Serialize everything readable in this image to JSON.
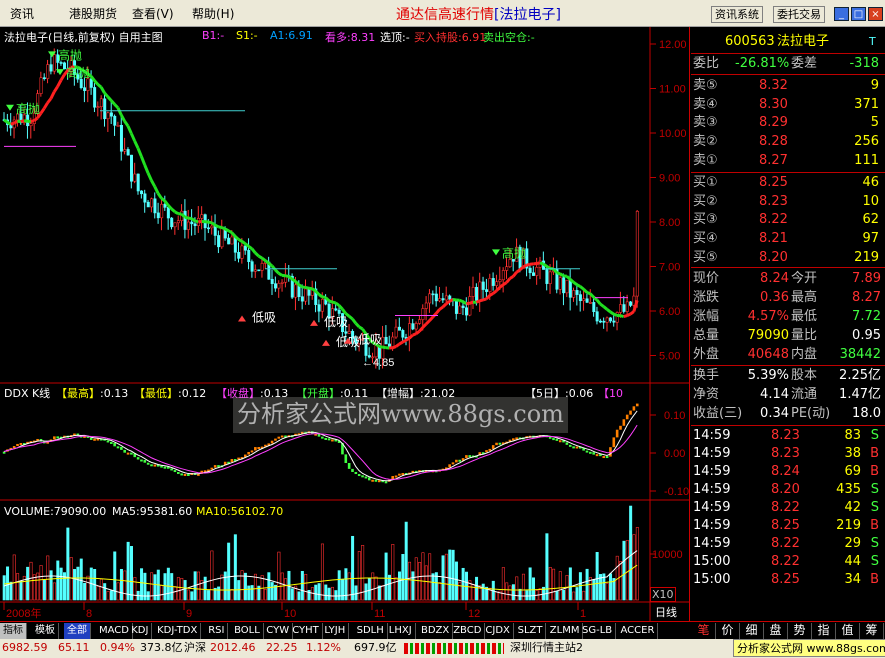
{
  "menu": {
    "items": [
      "资讯",
      "港股期货",
      "查看(V)",
      "帮助(H)"
    ],
    "title": "通达信高速行情",
    "stock_bracket": "[法拉电子]",
    "btn_info": "资讯系统",
    "btn_trade": "委托交易"
  },
  "chart": {
    "header": "法拉电子(日线,前复权) 自用主图",
    "indicators": [
      {
        "label": "B1:-",
        "color": "#ff40ff"
      },
      {
        "label": "S1:-",
        "color": "#ffff00"
      },
      {
        "label": "A1:6.91",
        "color": "#00a0ff"
      },
      {
        "label": "看多:8.31",
        "color": "#ff40ff"
      },
      {
        "label": "选顶:-",
        "color": "#ffffff"
      },
      {
        "label": "买入持股:6.91",
        "color": "#ff3030"
      },
      {
        "label": "卖出空仓:-",
        "color": "#40ff40"
      }
    ],
    "price_ticks": [
      "12.00",
      "11.00",
      "10.00",
      "9.00",
      "8.00",
      "7.00",
      "6.00",
      "5.00"
    ],
    "annotations": {
      "high_sell": "高抛",
      "low_buy": "低吸",
      "low_mark": "4.85"
    },
    "ddx": {
      "label": "DDX K线",
      "items": [
        {
          "k": "【最高】",
          "v": ":0.13"
        },
        {
          "k": "【最低】",
          "v": ":0.12"
        },
        {
          "k": "【收盘】",
          "v": ":0.13"
        },
        {
          "k": "【开盘】",
          "v": ":0.11"
        },
        {
          "k": "【增幅】",
          "v": ":21.02"
        },
        {
          "k": "【5日】",
          "v": ":0.06"
        },
        {
          "k": "【10",
          "v": ""
        }
      ],
      "ticks": [
        "0.10",
        "0.00",
        "-0.10"
      ]
    },
    "volume": {
      "label": "VOLUME:79090.00",
      "ma5": "MA5:95381.60",
      "ma10": "MA10:56102.70",
      "tick": "10000",
      "unit": "X10"
    },
    "time_axis": [
      "2008年",
      "8",
      "9",
      "10",
      "11",
      "12",
      "1"
    ],
    "period": "日线",
    "watermark": "分析家公式网www.88gs.com",
    "chart_data": {
      "type": "candlestick",
      "x": [
        "2008-07",
        "2008-08",
        "2008-09",
        "2008-10",
        "2008-11",
        "2008-12",
        "2009-01"
      ],
      "ylim": [
        4.7,
        12.1
      ],
      "y_ticks": [
        5,
        6,
        7,
        8,
        9,
        10,
        11,
        12
      ],
      "price_high": 11.9,
      "price_low": 4.85,
      "last_close": 8.24
    }
  },
  "quote": {
    "code": "600563",
    "name": "法拉电子",
    "weibi_label": "委比",
    "weibi": "-26.81%",
    "weicha_label": "委差",
    "weicha": "-318",
    "asks": [
      {
        "label": "卖⑤",
        "price": "8.32",
        "vol": "9"
      },
      {
        "label": "卖④",
        "price": "8.30",
        "vol": "371"
      },
      {
        "label": "卖③",
        "price": "8.29",
        "vol": "5"
      },
      {
        "label": "卖②",
        "price": "8.28",
        "vol": "256"
      },
      {
        "label": "卖①",
        "price": "8.27",
        "vol": "111"
      }
    ],
    "bids": [
      {
        "label": "买①",
        "price": "8.25",
        "vol": "46"
      },
      {
        "label": "买②",
        "price": "8.23",
        "vol": "10"
      },
      {
        "label": "买③",
        "price": "8.22",
        "vol": "62"
      },
      {
        "label": "买④",
        "price": "8.21",
        "vol": "97"
      },
      {
        "label": "买⑤",
        "price": "8.20",
        "vol": "219"
      }
    ],
    "stats": [
      {
        "l1": "现价",
        "v1": "8.24",
        "c1": "#ff3030",
        "l2": "今开",
        "v2": "7.89",
        "c2": "#ff3030"
      },
      {
        "l1": "涨跌",
        "v1": "0.36",
        "c1": "#ff3030",
        "l2": "最高",
        "v2": "8.27",
        "c2": "#ff3030"
      },
      {
        "l1": "涨幅",
        "v1": "4.57%",
        "c1": "#ff3030",
        "l2": "最低",
        "v2": "7.72",
        "c2": "#40ff40"
      },
      {
        "l1": "总量",
        "v1": "79090",
        "c1": "#ffff00",
        "l2": "量比",
        "v2": "0.95",
        "c2": "#ffffff"
      },
      {
        "l1": "外盘",
        "v1": "40648",
        "c1": "#ff3030",
        "l2": "内盘",
        "v2": "38442",
        "c2": "#40ff40"
      }
    ],
    "fin": [
      {
        "l1": "换手",
        "v1": "5.39%",
        "l2": "股本",
        "v2": "2.25亿"
      },
      {
        "l1": "净资",
        "v1": "4.14",
        "l2": "流通",
        "v2": "1.47亿"
      },
      {
        "l1": "收益(三)",
        "v1": "0.34",
        "l2": "PE(动)",
        "v2": "18.0"
      }
    ],
    "ticks": [
      {
        "time": "14:59",
        "price": "8.23",
        "vol": "83",
        "side": "S"
      },
      {
        "time": "14:59",
        "price": "8.23",
        "vol": "38",
        "side": "B"
      },
      {
        "time": "14:59",
        "price": "8.24",
        "vol": "69",
        "side": "B"
      },
      {
        "time": "14:59",
        "price": "8.20",
        "vol": "435",
        "side": "S"
      },
      {
        "time": "14:59",
        "price": "8.22",
        "vol": "42",
        "side": "S"
      },
      {
        "time": "14:59",
        "price": "8.25",
        "vol": "219",
        "side": "B"
      },
      {
        "time": "14:59",
        "price": "8.22",
        "vol": "29",
        "side": "S"
      },
      {
        "time": "15:00",
        "price": "8.22",
        "vol": "44",
        "side": "S"
      },
      {
        "time": "15:00",
        "price": "8.25",
        "vol": "34",
        "side": "B"
      }
    ],
    "side_tabs": [
      "笔",
      "价",
      "细",
      "盘",
      "势",
      "指",
      "值",
      "筹"
    ]
  },
  "bottom_tabs": [
    "指标",
    "模板",
    "全部",
    "MACD",
    "KDJ",
    "KDJ-TDX",
    "RSI",
    "BOLL",
    "CYW",
    "CYHT",
    "LYJH",
    "SDLH",
    "LHXJ",
    "BDZX",
    "ZBCD",
    "CJDX",
    "SLZT",
    "ZLMM",
    "SG-LB",
    "ACCER"
  ],
  "status": {
    "sh": "6982.59",
    "sh_chg": "65.11",
    "sh_pct": "0.94%",
    "sh_amt": "373.8亿",
    "hs_label": "沪深",
    "hs": "2012.46",
    "hs_chg": "22.25",
    "hs_pct": "1.12%",
    "hs_amt": "697.9亿",
    "station": "深圳行情主站2",
    "site": "分析家公式网 www.88gs.com"
  }
}
